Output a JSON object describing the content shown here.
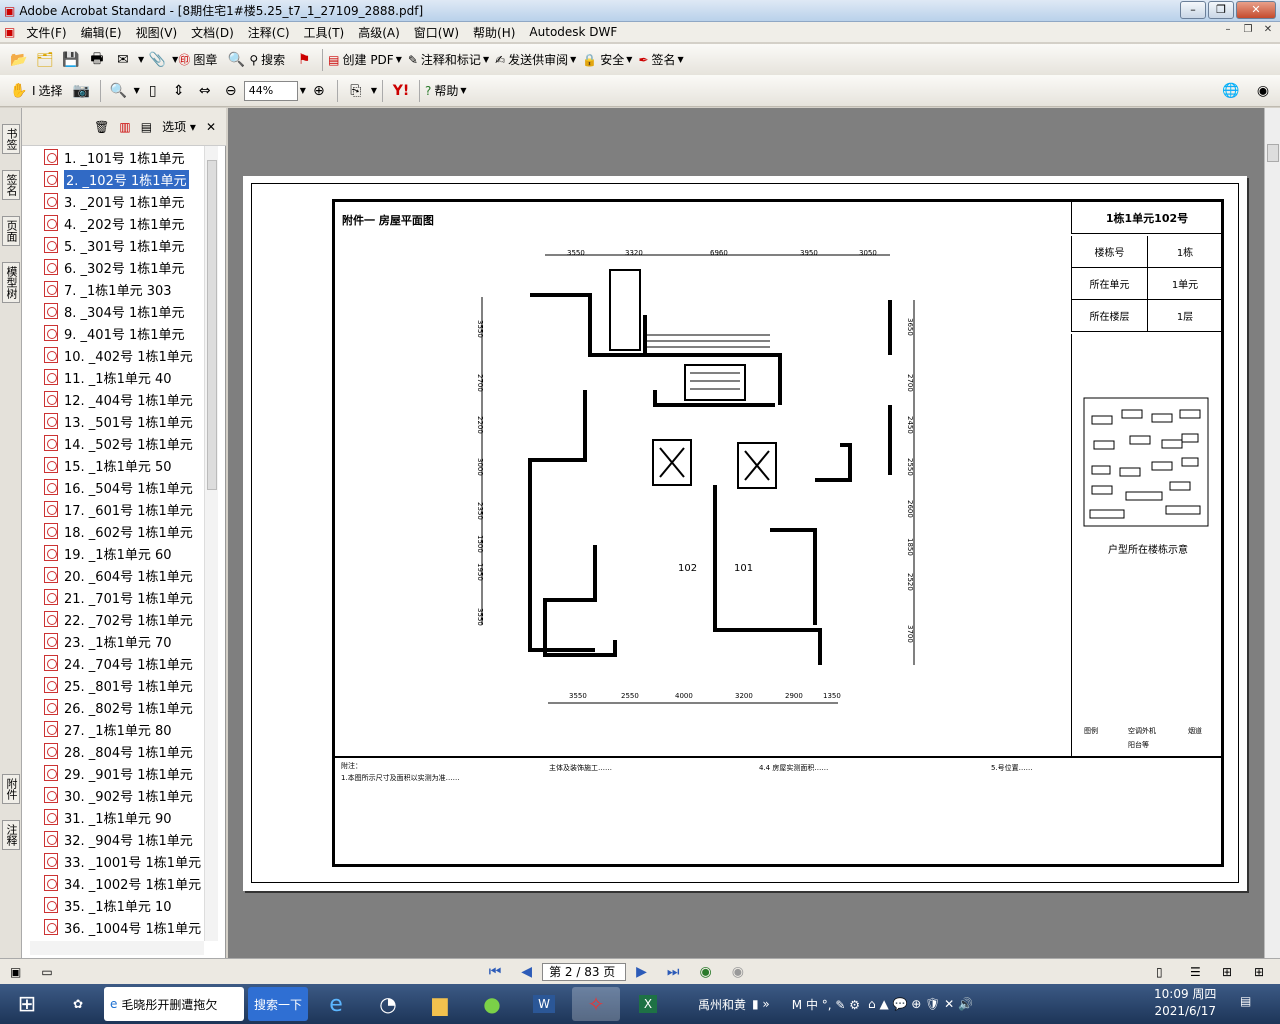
{
  "window": {
    "title": "Adobe Acrobat Standard - [8期住宅1#楼5.25_t7_1_27109_2888.pdf]"
  },
  "menu": [
    "文件(F)",
    "编辑(E)",
    "视图(V)",
    "文档(D)",
    "注释(C)",
    "工具(T)",
    "高级(A)",
    "窗口(W)",
    "帮助(H)",
    "Autodesk DWF"
  ],
  "toolbar1": {
    "stamp": "图章",
    "search": "搜索",
    "create_pdf": "创建 PDF",
    "comment": "注释和标记",
    "send_review": "发送供审阅",
    "security": "安全",
    "sign": "签名"
  },
  "toolbar2": {
    "select": "选择",
    "zoom": "44%",
    "help": "帮助"
  },
  "left_tabs": [
    "书签",
    "签名",
    "页面",
    "模型树",
    "附件",
    "注释"
  ],
  "panel": {
    "options": "选项"
  },
  "bookmarks": [
    "1. _101号 1栋1单元",
    "2. _102号 1栋1单元",
    "3. _201号 1栋1单元",
    "4. _202号 1栋1单元",
    "5. _301号 1栋1单元",
    "6. _302号 1栋1单元",
    "7. _1栋1单元          303",
    "8. _304号 1栋1单元",
    "9. _401号 1栋1单元",
    "10. _402号 1栋1单元",
    "11. _1栋1单元          40",
    "12. _404号 1栋1单元",
    "13. _501号 1栋1单元",
    "14. _502号 1栋1单元",
    "15. _1栋1单元          50",
    "16. _504号 1栋1单元",
    "17. _601号 1栋1单元",
    "18. _602号 1栋1单元",
    "19. _1栋1单元          60",
    "20. _604号 1栋1单元",
    "21. _701号 1栋1单元",
    "22. _702号 1栋1单元",
    "23. _1栋1单元          70",
    "24. _704号 1栋1单元",
    "25. _801号 1栋1单元",
    "26. _802号 1栋1单元",
    "27. _1栋1单元          80",
    "28. _804号 1栋1单元",
    "29. _901号 1栋1单元",
    "30. _902号 1栋1单元",
    "31. _1栋1单元          90",
    "32. _904号 1栋1单元",
    "33. _1001号 1栋1单元",
    "34. _1002号 1栋1单元",
    "35. _1栋1单元          10",
    "36. _1004号 1栋1单元"
  ],
  "doc": {
    "heading": "附件一  房屋平面图",
    "unit_title": "1栋1单元102号",
    "info": [
      {
        "k": "楼栋号",
        "v": "1栋"
      },
      {
        "k": "所在单元",
        "v": "1单元"
      },
      {
        "k": "所在楼层",
        "v": "1层"
      }
    ],
    "site_caption": "户型所在楼栋示意",
    "room_a": "102",
    "room_b": "101",
    "dims_top": [
      "3550",
      "3320",
      "6960",
      "3950",
      "3050"
    ],
    "dims_bottom": [
      "3550",
      "2550",
      "4000",
      "3200",
      "2900",
      "1350"
    ],
    "dims_left": [
      "3550",
      "2700",
      "2200",
      "3000",
      "2350",
      "1500",
      "1950",
      "3550"
    ],
    "dims_right": [
      "3650",
      "2700",
      "2450",
      "2550",
      "2600",
      "1850",
      "2520",
      "3700"
    ],
    "legend": [
      "图例",
      "空调外机",
      "烟道",
      "阳台等"
    ],
    "notes": [
      "附注：",
      "1.本图所示尺寸及面积以实测为准……",
      "主体及装饰施工……",
      "4.4 房屋实测面积……",
      "5.号位置……"
    ]
  },
  "status": {
    "page": "第 2 / 83 页"
  },
  "taskbar": {
    "ie_task": "毛晓彤开删遭拖欠",
    "search": "搜索一下",
    "ime_text": "禹州和黄",
    "time": "10:09 周四",
    "date": "2021/6/17"
  }
}
